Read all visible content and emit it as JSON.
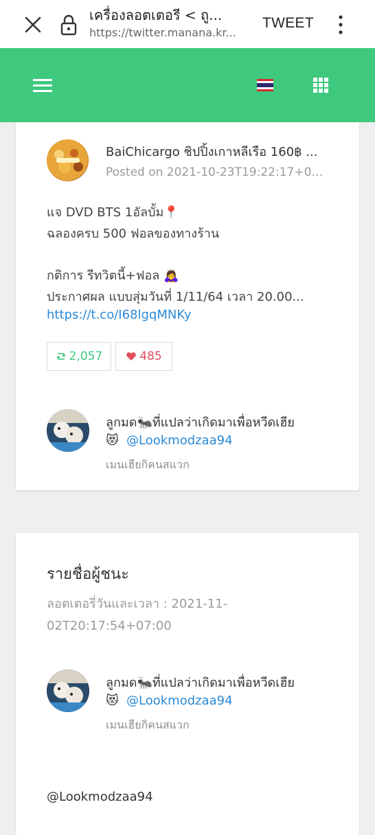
{
  "browser": {
    "title": "เครื่องลอตเตอรี < ถู...",
    "url": "https://twitter.manana.kr...",
    "tweet_button": "TWEET"
  },
  "header": {
    "bg_color": "#3ec97e",
    "icons": [
      "menu-icon",
      "thailand-flag-icon",
      "grid-icon"
    ]
  },
  "tweet": {
    "author": "BaiChicargo ชิปปิ้งเกาหลีเรือ 160฿ ...",
    "posted": "Posted on 2021-10-23T19:22:17+07...",
    "lines": [
      "แจ DVD BTS 1อัลบั้ม📍",
      "ฉลองครบ 500 ฟอลของทางร้าน",
      "กติการ รีทวิตนี้+ฟอล 🙇‍♀️",
      "ประกาศผล แบบสุ่มวันที่ 1/11/64 เวลา 20.00..."
    ],
    "link": "https://t.co/I68lgqMNKy",
    "retweets": "2,057",
    "likes": "485"
  },
  "tweet_user": {
    "name": "ลูกมด🐜ที่แปลว่าเกิดมาเพื่อหวีดเฮีย",
    "emoji": "😻",
    "handle": "@Lookmodzaa94",
    "bio": "เมนเฮียกิคนสแวก"
  },
  "winners": {
    "title": "รายชื่อผู้ชนะ",
    "lottery_time_line1": "ลอตเตอรี่วันและเวลา : 2021-11-",
    "lottery_time_line2": "02T20:17:54+07:00",
    "winner": {
      "name": "ลูกมด🐜ที่แปลว่าเกิดมาเพื่อหวีดเฮีย",
      "emoji": "😻",
      "handle": "@Lookmodzaa94",
      "bio": "เมนเฮียกิคนสแวก"
    },
    "winner_handle": "@Lookmodzaa94"
  }
}
